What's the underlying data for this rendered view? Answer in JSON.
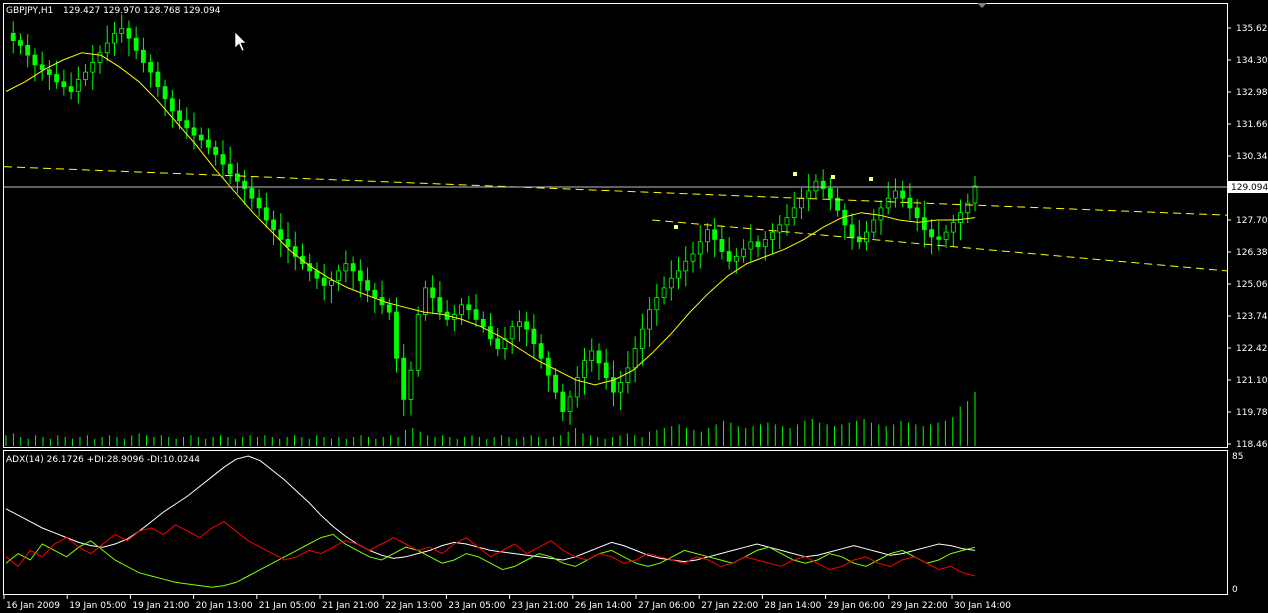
{
  "main_header": {
    "symbol": "GBPJPY,H1",
    "ohlc": "129.427 129.970 128.768 129.094"
  },
  "indicator_header": {
    "text": "ADX(14) 26.1726 +DI:28.9096 -DI:10.0244"
  },
  "current_price_label": "129.094",
  "indicator_scale": {
    "top": "85",
    "bottom": "0"
  },
  "colors": {
    "background": "#000000",
    "frame": "#FFFFFF",
    "candles": "#00FF00",
    "moving_average": "#FFFF00",
    "trendline": "#FFFF00",
    "volume": "#00FF00",
    "adx": "#FFFFFF",
    "plus_di": "#7FFF00",
    "minus_di": "#FF0000",
    "price_line": "#C0C0C0"
  },
  "chart_data": {
    "type": "line",
    "price_axis": {
      "ticks": [
        "135.620",
        "134.300",
        "132.980",
        "131.660",
        "130.340",
        "129.094",
        "127.700",
        "126.380",
        "125.060",
        "123.740",
        "122.420",
        "121.100",
        "119.780",
        "118.460"
      ]
    },
    "time_axis": {
      "ticks": [
        "16 Jan 2009",
        "19 Jan 05:00",
        "19 Jan 21:00",
        "20 Jan 13:00",
        "21 Jan 05:00",
        "21 Jan 21:00",
        "22 Jan 13:00",
        "23 Jan 05:00",
        "23 Jan 21:00",
        "26 Jan 14:00",
        "27 Jan 06:00",
        "27 Jan 22:00",
        "28 Jan 14:00",
        "29 Jan 06:00",
        "29 Jan 22:00",
        "30 Jan 14:00"
      ]
    },
    "price_path": [
      135.4,
      135.1,
      134.9,
      134.5,
      134.1,
      133.9,
      133.7,
      133.4,
      133.2,
      133.0,
      133.5,
      133.8,
      134.2,
      134.6,
      135.0,
      135.4,
      135.6,
      135.2,
      134.7,
      134.2,
      133.8,
      133.2,
      132.7,
      132.2,
      131.8,
      131.5,
      131.2,
      131.0,
      130.7,
      130.4,
      130.0,
      129.6,
      129.3,
      129.0,
      128.6,
      128.2,
      127.7,
      127.3,
      126.9,
      126.6,
      126.2,
      125.9,
      125.6,
      125.3,
      125.0,
      125.2,
      125.6,
      125.9,
      125.6,
      125.2,
      124.8,
      124.5,
      124.2,
      123.9,
      122.0,
      120.3,
      121.5,
      123.8,
      124.9,
      124.5,
      123.9,
      123.6,
      123.8,
      124.2,
      124.0,
      123.6,
      123.3,
      122.8,
      122.4,
      122.8,
      123.3,
      123.5,
      123.2,
      122.6,
      122.0,
      121.3,
      120.6,
      119.8,
      120.4,
      121.2,
      121.9,
      122.3,
      121.8,
      121.2,
      120.6,
      121.0,
      121.6,
      122.4,
      123.2,
      124.0,
      124.5,
      124.9,
      125.3,
      125.6,
      126.0,
      126.3,
      126.8,
      127.3,
      126.9,
      126.4,
      126.0,
      126.2,
      126.5,
      126.8,
      126.6,
      126.9,
      127.2,
      127.5,
      127.8,
      128.2,
      128.6,
      128.9,
      129.3,
      129.0,
      128.6,
      128.1,
      127.5,
      127.0,
      126.8,
      127.2,
      127.7,
      128.2,
      128.6,
      128.9,
      128.6,
      128.2,
      127.8,
      127.3,
      127.0,
      126.9,
      127.2,
      127.6,
      128.0,
      128.4,
      129.1
    ],
    "moving_average": [
      133.0,
      133.4,
      133.9,
      134.3,
      134.6,
      134.5,
      134.0,
      133.4,
      132.6,
      131.7,
      130.8,
      129.8,
      128.9,
      128.0,
      127.2,
      126.4,
      125.8,
      125.3,
      124.9,
      124.6,
      124.3,
      124.1,
      123.9,
      123.8,
      123.6,
      123.3,
      122.9,
      122.4,
      121.9,
      121.5,
      121.1,
      120.9,
      121.1,
      121.5,
      122.2,
      123.0,
      123.9,
      124.7,
      125.4,
      125.9,
      126.2,
      126.5,
      126.9,
      127.4,
      127.8,
      128.0,
      127.9,
      127.7,
      127.6,
      127.7,
      127.7,
      127.8
    ],
    "trendlines": [
      {
        "name": "",
        "from": [
          0,
          129.9
        ],
        "to": [
          1,
          127.9
        ]
      },
      {
        "name": "",
        "from": [
          0.53,
          127.7
        ],
        "to": [
          1,
          125.6
        ]
      }
    ],
    "volume": [
      6,
      7,
      5,
      4,
      6,
      5,
      4,
      6,
      5,
      4,
      5,
      6,
      4,
      5,
      6,
      5,
      4,
      6,
      7,
      6,
      5,
      6,
      5,
      4,
      5,
      6,
      5,
      4,
      5,
      6,
      5,
      4,
      5,
      6,
      5,
      6,
      5,
      4,
      5,
      6,
      5,
      4,
      6,
      5,
      4,
      5,
      4,
      5,
      6,
      5,
      4,
      5,
      6,
      5,
      9,
      10,
      8,
      6,
      5,
      6,
      5,
      4,
      5,
      6,
      5,
      4,
      5,
      6,
      5,
      4,
      5,
      6,
      5,
      4,
      5,
      6,
      8,
      10,
      7,
      6,
      5,
      4,
      5,
      6,
      7,
      6,
      5,
      8,
      9,
      10,
      11,
      12,
      10,
      9,
      8,
      10,
      12,
      14,
      13,
      11,
      10,
      11,
      12,
      13,
      12,
      11,
      10,
      12,
      14,
      15,
      13,
      12,
      11,
      12,
      13,
      14,
      15,
      13,
      12,
      11,
      12,
      14,
      13,
      12,
      11,
      12,
      13,
      14,
      16,
      22,
      25,
      30
    ],
    "series": [
      {
        "name": "ADX(14)",
        "values": [
          52,
          48,
          44,
          40,
          37,
          34,
          31,
          29,
          28,
          30,
          33,
          38,
          44,
          50,
          55,
          60,
          66,
          72,
          78,
          83,
          85,
          82,
          76,
          70,
          63,
          56,
          48,
          41,
          35,
          30,
          26,
          23,
          21,
          22,
          24,
          26,
          29,
          31,
          30,
          28,
          26,
          25,
          24,
          23,
          22,
          21,
          20,
          22,
          25,
          28,
          31,
          29,
          26,
          23,
          21,
          20,
          19,
          20,
          22,
          24,
          26,
          28,
          30,
          28,
          26,
          24,
          22,
          23,
          25,
          27,
          29,
          27,
          25,
          23,
          24,
          26,
          28,
          30,
          29,
          27,
          26
        ]
      },
      {
        "name": "+DI",
        "values": [
          18,
          24,
          20,
          30,
          26,
          22,
          28,
          32,
          26,
          20,
          16,
          12,
          10,
          8,
          6,
          5,
          4,
          3,
          4,
          6,
          10,
          14,
          18,
          22,
          26,
          30,
          34,
          36,
          30,
          26,
          22,
          20,
          24,
          28,
          26,
          22,
          18,
          20,
          24,
          22,
          18,
          14,
          16,
          20,
          24,
          22,
          18,
          16,
          20,
          24,
          26,
          22,
          18,
          16,
          18,
          22,
          26,
          24,
          22,
          20,
          18,
          22,
          26,
          28,
          24,
          20,
          18,
          20,
          24,
          22,
          18,
          16,
          20,
          24,
          26,
          22,
          18,
          20,
          24,
          26,
          28
        ]
      },
      {
        "name": "-DI",
        "values": [
          22,
          16,
          26,
          22,
          30,
          34,
          28,
          24,
          30,
          36,
          32,
          38,
          40,
          36,
          42,
          38,
          34,
          40,
          44,
          38,
          32,
          28,
          24,
          20,
          22,
          26,
          24,
          28,
          32,
          30,
          26,
          30,
          34,
          30,
          26,
          28,
          24,
          30,
          34,
          28,
          22,
          26,
          30,
          24,
          28,
          32,
          26,
          22,
          20,
          24,
          22,
          18,
          20,
          24,
          22,
          20,
          18,
          22,
          20,
          16,
          18,
          22,
          20,
          18,
          16,
          20,
          22,
          18,
          14,
          16,
          20,
          22,
          18,
          16,
          20,
          22,
          18,
          14,
          16,
          12,
          10
        ]
      }
    ]
  }
}
